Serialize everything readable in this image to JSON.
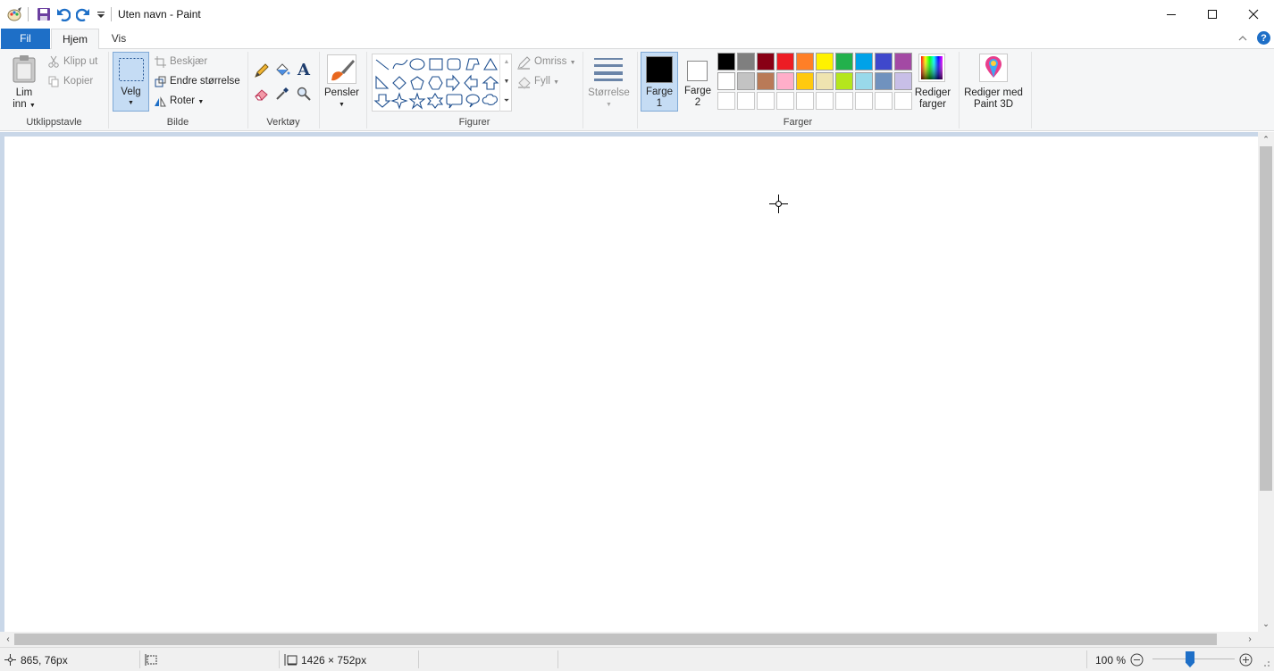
{
  "window": {
    "title": "Uten navn - Paint"
  },
  "tabs": {
    "file": "Fil",
    "home": "Hjem",
    "view": "Vis"
  },
  "clipboard": {
    "paste_line1": "Lim",
    "paste_line2": "inn",
    "cut": "Klipp ut",
    "copy": "Kopier",
    "group": "Utklippstavle"
  },
  "image": {
    "select": "Velg",
    "crop": "Beskjær",
    "resize": "Endre størrelse",
    "rotate": "Roter",
    "group": "Bilde"
  },
  "tools": {
    "group": "Verktøy"
  },
  "brushes": {
    "label": "Pensler"
  },
  "shapes": {
    "outline": "Omriss",
    "fill": "Fyll",
    "group": "Figurer"
  },
  "size": {
    "label": "Størrelse"
  },
  "colors": {
    "color1_line1": "Farge",
    "color1_line2": "1",
    "color2_line1": "Farge",
    "color2_line2": "2",
    "edit_line1": "Rediger",
    "edit_line2": "farger",
    "group": "Farger",
    "color1_value": "#000000",
    "color2_value": "#ffffff",
    "palette_row1": [
      "#000000",
      "#7f7f7f",
      "#880015",
      "#ed1c24",
      "#ff7f27",
      "#fff200",
      "#22b14c",
      "#00a2e8",
      "#3f48cc",
      "#a349a4"
    ],
    "palette_row2": [
      "#ffffff",
      "#c3c3c3",
      "#b97a57",
      "#ffaec9",
      "#ffc90e",
      "#efe4b0",
      "#b5e61d",
      "#99d9ea",
      "#7092be",
      "#c8bfe7"
    ]
  },
  "paint3d": {
    "line1": "Rediger med",
    "line2": "Paint 3D"
  },
  "status": {
    "cursor_pos": "865, 76px",
    "canvas_size": "1426 × 752px",
    "zoom": "100 %"
  }
}
